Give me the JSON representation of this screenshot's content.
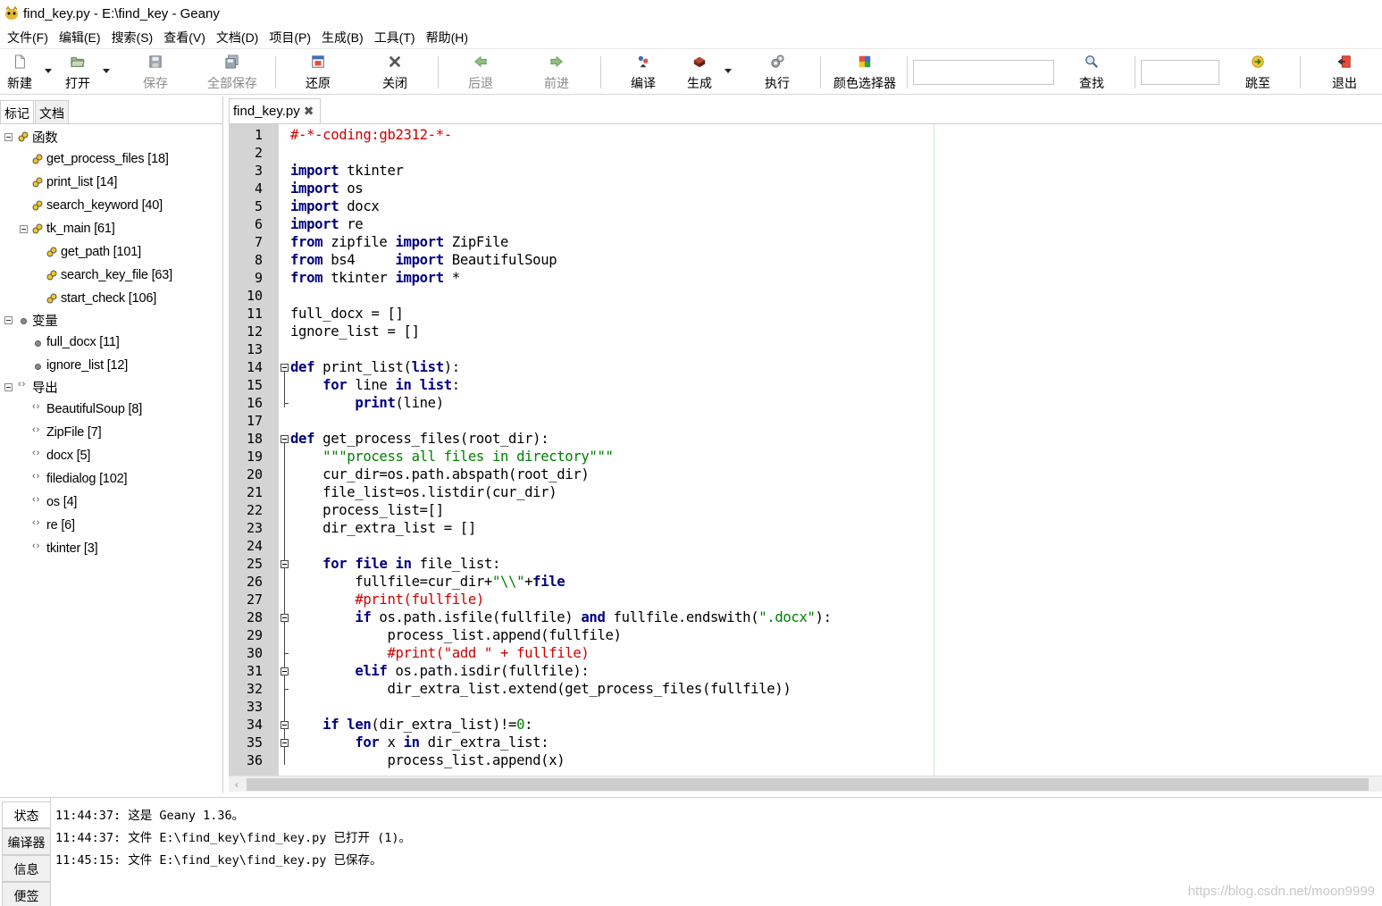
{
  "window": {
    "title": "find_key.py - E:\\find_key - Geany"
  },
  "menubar": [
    "文件(F)",
    "编辑(E)",
    "搜索(S)",
    "查看(V)",
    "文档(D)",
    "项目(P)",
    "生成(B)",
    "工具(T)",
    "帮助(H)"
  ],
  "toolbar": {
    "new": "新建",
    "open": "打开",
    "save": "保存",
    "save_all": "全部保存",
    "revert": "还原",
    "close": "关闭",
    "back": "后退",
    "forward": "前进",
    "compile": "编译",
    "build": "生成",
    "execute": "执行",
    "color_chooser": "颜色选择器",
    "search_value": "",
    "find": "查找",
    "goto_value": "",
    "goto": "跳至",
    "quit": "退出"
  },
  "sidebar": {
    "tabs": [
      "标记",
      "文档"
    ],
    "groups": [
      {
        "label": "函数",
        "items": [
          "get_process_files [18]",
          "print_list [14]",
          "search_keyword [40]",
          "tk_main [61]"
        ],
        "sub_items": [
          "get_path [101]",
          "search_key_file [63]",
          "start_check [106]"
        ]
      },
      {
        "label": "变量",
        "items": [
          "full_docx [11]",
          "ignore_list [12]"
        ]
      },
      {
        "label": "导出",
        "items": [
          "BeautifulSoup [8]",
          "ZipFile [7]",
          "docx [5]",
          "filedialog [102]",
          "os [4]",
          "re [6]",
          "tkinter [3]"
        ]
      }
    ]
  },
  "editor": {
    "tab": "find_key.py",
    "line_numbers": [
      "1",
      "2",
      "3",
      "4",
      "5",
      "6",
      "7",
      "8",
      "9",
      "10",
      "11",
      "12",
      "13",
      "14",
      "15",
      "16",
      "17",
      "18",
      "19",
      "20",
      "21",
      "22",
      "23",
      "24",
      "25",
      "26",
      "27",
      "28",
      "29",
      "30",
      "31",
      "32",
      "33",
      "34",
      "35",
      "36"
    ],
    "lines": [
      "#-*-coding:gb2312-*-",
      "",
      "import tkinter",
      "import os",
      "import docx",
      "import re",
      "from zipfile import ZipFile",
      "from bs4     import BeautifulSoup",
      "from tkinter import *",
      "",
      "full_docx = []",
      "ignore_list = []",
      "",
      "def print_list(list):",
      "    for line in list:",
      "        print(line)",
      "",
      "def get_process_files(root_dir):",
      "    \"\"\"process all files in directory\"\"\"",
      "    cur_dir=os.path.abspath(root_dir)",
      "    file_list=os.listdir(cur_dir)",
      "    process_list=[]",
      "    dir_extra_list = []",
      "",
      "    for file in file_list:",
      "        fullfile=cur_dir+\"\\\\\"+file",
      "        #print(fullfile)",
      "        if os.path.isfile(fullfile) and fullfile.endswith(\".docx\"):",
      "            process_list.append(fullfile)",
      "            #print(\"add \" + fullfile)",
      "        elif os.path.isdir(fullfile):",
      "            dir_extra_list.extend(get_process_files(fullfile))",
      "",
      "    if len(dir_extra_list)!=0:",
      "        for x in dir_extra_list:",
      "            process_list.append(x)"
    ]
  },
  "messages": {
    "tabs": [
      "状态",
      "编译器",
      "信息",
      "便签"
    ],
    "lines": [
      "11:44:37: 这是 Geany 1.36。",
      "11:44:37: 文件 E:\\find_key\\find_key.py 已打开 (1)。",
      "11:45:15: 文件 E:\\find_key\\find_key.py 已保存。"
    ]
  },
  "watermark": "https://blog.csdn.net/moon9999"
}
